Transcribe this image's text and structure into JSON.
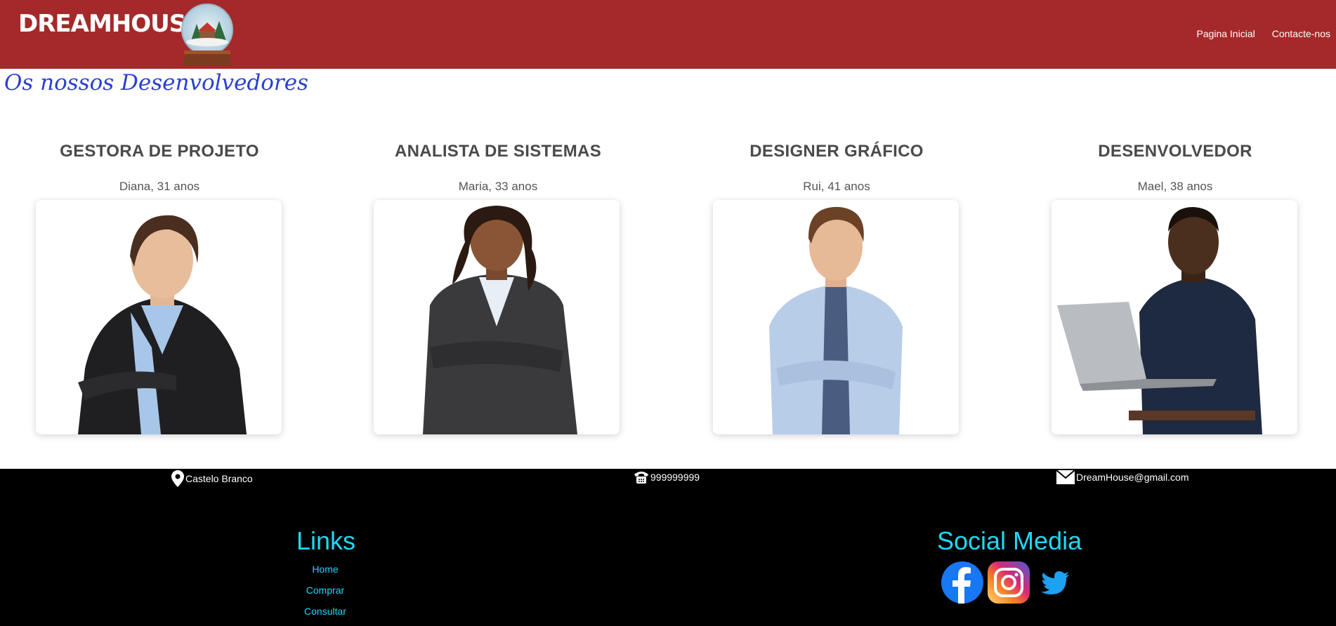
{
  "header": {
    "logo": "DreamHouse",
    "nav": [
      "Pagina Inicial",
      "Contacte-nos"
    ]
  },
  "page_title": "Os nossos Desenvolvedores",
  "developers": [
    {
      "role": "GESTORA DE PROJETO",
      "person": "Diana, 31 anos"
    },
    {
      "role": "ANALISTA DE SISTEMAS",
      "person": "Maria, 33 anos"
    },
    {
      "role": "DESIGNER GRÁFICO",
      "person": "Rui, 41 anos"
    },
    {
      "role": "DESENVOLVEDOR",
      "person": "Mael, 38 anos"
    }
  ],
  "footer": {
    "location": "Castelo Branco",
    "phone": "999999999",
    "email": "DreamHouse@gmail.com",
    "links_title": "Links",
    "links": [
      "Home",
      "Comprar",
      "Consultar"
    ],
    "social_title": "Social Media"
  },
  "colors": {
    "header_bg": "#a5292a",
    "title_blue": "#2a3fd0",
    "footer_accent": "#1fd8f4",
    "footer_bg": "#000000"
  },
  "icons": [
    "snow-globe-icon",
    "location-pin-icon",
    "phone-icon",
    "envelope-icon",
    "facebook-icon",
    "instagram-icon",
    "twitter-icon"
  ]
}
